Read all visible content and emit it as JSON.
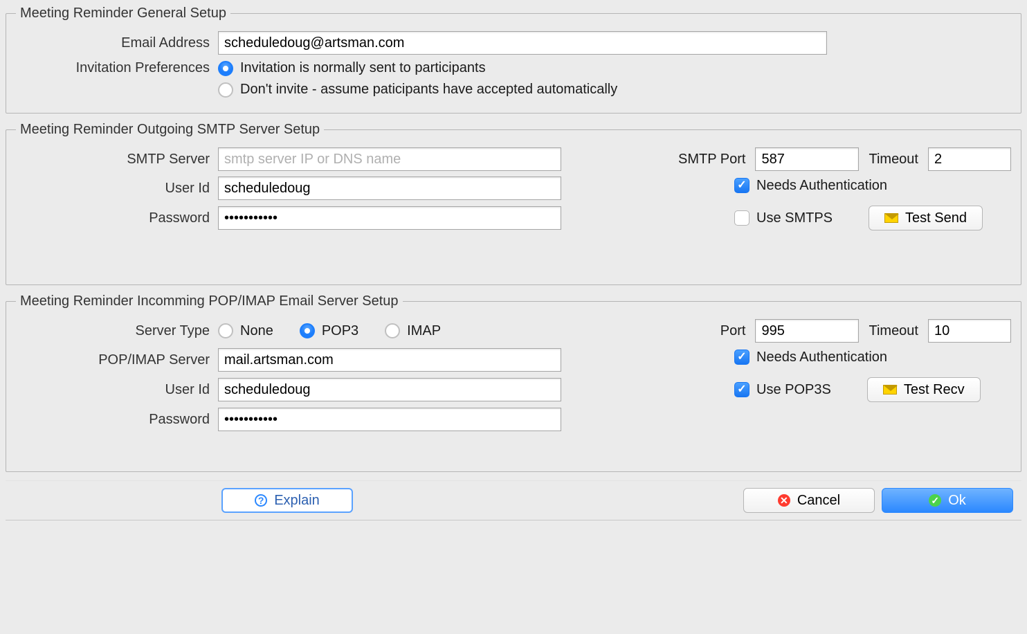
{
  "general": {
    "legend": "Meeting Reminder General Setup",
    "email_label": "Email Address",
    "email_value": "scheduledoug@artsman.com",
    "invite_label": "Invitation Preferences",
    "radio_sent": "Invitation is normally sent to participants",
    "radio_no": "Don't invite - assume paticipants have accepted automatically"
  },
  "smtp": {
    "legend": "Meeting Reminder Outgoing SMTP Server Setup",
    "server_label": "SMTP Server",
    "server_placeholder": "smtp server IP or DNS name",
    "server_value": "",
    "user_label": "User Id",
    "user_value": "scheduledoug",
    "pass_label": "Password",
    "pass_value": "•••••••••••",
    "port_label": "SMTP Port",
    "port_value": "587",
    "timeout_label": "Timeout",
    "timeout_value": "2",
    "needs_auth": "Needs Authentication",
    "use_smtps": "Use SMTPS",
    "test_send": "Test Send"
  },
  "incoming": {
    "legend": "Meeting Reminder Incomming POP/IMAP Email Server Setup",
    "type_label": "Server Type",
    "radio_none": "None",
    "radio_pop3": "POP3",
    "radio_imap": "IMAP",
    "server_label": "POP/IMAP Server",
    "server_value": "mail.artsman.com",
    "user_label": "User Id",
    "user_value": "scheduledoug",
    "pass_label": "Password",
    "pass_value": "•••••••••••",
    "port_label": "Port",
    "port_value": "995",
    "timeout_label": "Timeout",
    "timeout_value": "10",
    "needs_auth": "Needs Authentication",
    "use_pop3s": "Use POP3S",
    "test_recv": "Test Recv"
  },
  "footer": {
    "explain": "Explain",
    "cancel": "Cancel",
    "ok": "Ok"
  }
}
